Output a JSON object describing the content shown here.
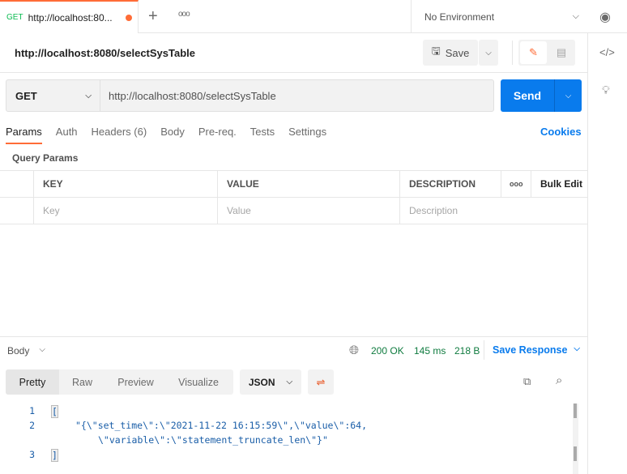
{
  "tab": {
    "method": "GET",
    "title": "http://localhost:80..."
  },
  "environment": "No Environment",
  "request": {
    "title": "http://localhost:8080/selectSysTable",
    "save": "Save",
    "method": "GET",
    "url": "http://localhost:8080/selectSysTable",
    "send": "Send"
  },
  "req_tabs": [
    "Params",
    "Auth",
    "Headers (6)",
    "Body",
    "Pre-req.",
    "Tests",
    "Settings"
  ],
  "cookies": "Cookies",
  "query_params": "Query Params",
  "table": {
    "headers": [
      "KEY",
      "VALUE",
      "DESCRIPTION"
    ],
    "bulk_edit": "Bulk Edit",
    "placeholders": [
      "Key",
      "Value",
      "Description"
    ]
  },
  "response": {
    "body": "Body",
    "status": "200 OK",
    "time": "145 ms",
    "size": "218 B",
    "save": "Save Response",
    "tabs": [
      "Pretty",
      "Raw",
      "Preview",
      "Visualize"
    ],
    "format": "JSON",
    "lines": [
      {
        "n": "1",
        "text": "["
      },
      {
        "n": "2",
        "text": "\"{\\\"set_time\\\":\\\"2021-11-22 16:15:59\\\",\\\"value\\\":64,"
      },
      {
        "n": "",
        "text": "\\\"variable\\\":\\\"statement_truncate_len\\\"}\""
      },
      {
        "n": "3",
        "text": "]"
      }
    ]
  }
}
